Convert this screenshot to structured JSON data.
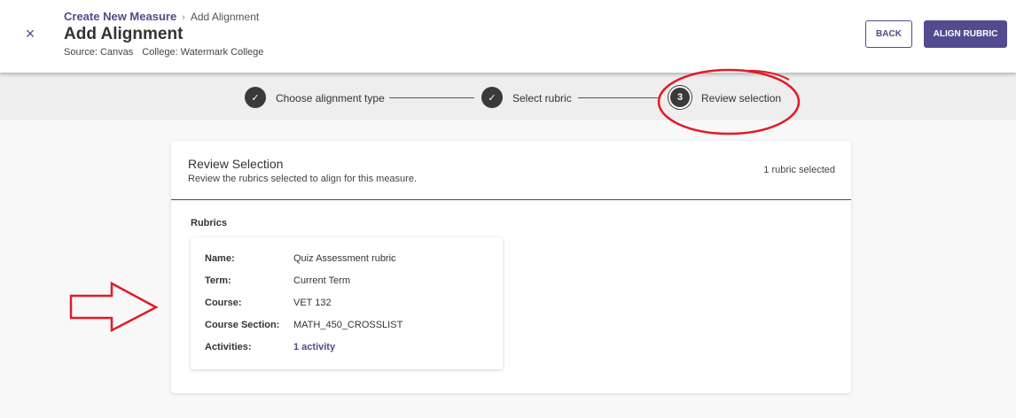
{
  "header": {
    "close_label": "×",
    "breadcrumb": {
      "parent": "Create New Measure",
      "separator": "›",
      "current": "Add Alignment"
    },
    "title": "Add Alignment",
    "source": "Source: Canvas",
    "college": "College: Watermark College",
    "back_label": "BACK",
    "align_label": "ALIGN RUBRIC"
  },
  "stepper": {
    "steps": [
      {
        "marker": "✓",
        "label": "Choose alignment type",
        "state": "complete"
      },
      {
        "marker": "✓",
        "label": "Select rubric",
        "state": "complete"
      },
      {
        "marker": "3",
        "label": "Review selection",
        "state": "active"
      }
    ]
  },
  "review": {
    "title": "Review Selection",
    "subtitle": "Review the rubrics selected to align for this measure.",
    "count": "1 rubric selected",
    "section_label": "Rubrics",
    "rubric": {
      "fields": [
        {
          "label": "Name:",
          "value": "Quiz Assessment rubric"
        },
        {
          "label": "Term:",
          "value": "Current Term"
        },
        {
          "label": "Course:",
          "value": "VET 132"
        },
        {
          "label": "Course Section:",
          "value": "MATH_450_CROSSLIST"
        },
        {
          "label": "Activities:",
          "value": "1 activity"
        }
      ]
    }
  },
  "colors": {
    "primary": "#524b8f",
    "header_bg": "#ffffff",
    "stepper_bg": "#eeeeee",
    "annotation": "#e01b24"
  }
}
